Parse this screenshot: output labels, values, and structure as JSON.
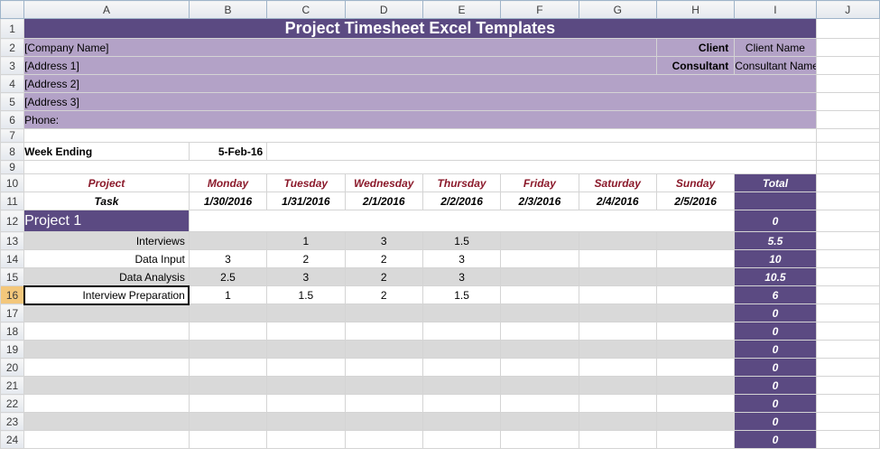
{
  "columns": [
    "A",
    "B",
    "C",
    "D",
    "E",
    "F",
    "G",
    "H",
    "I",
    "J"
  ],
  "rowcount": 24,
  "title": "Project Timesheet Excel Templates",
  "company": {
    "name": "[Company Name]",
    "addr1": "[Address 1]",
    "addr2": "[Address 2]",
    "addr3": "[Address 3]",
    "phone_label": "Phone:"
  },
  "client_label": "Client",
  "client_value": "Client Name",
  "consultant_label": "Consultant",
  "consultant_value": "Consultant Name",
  "week_ending_label": "Week Ending",
  "week_ending_value": "5-Feb-16",
  "headers": {
    "project": "Project",
    "task": "Task",
    "days": [
      "Monday",
      "Tuesday",
      "Wednesday",
      "Thursday",
      "Friday",
      "Saturday",
      "Sunday"
    ],
    "dates": [
      "1/30/2016",
      "1/31/2016",
      "2/1/2016",
      "2/2/2016",
      "2/3/2016",
      "2/4/2016",
      "2/5/2016"
    ],
    "total": "Total"
  },
  "project_name": "Project 1",
  "tasks": [
    {
      "name": "Interviews",
      "vals": [
        "",
        "1",
        "3",
        "1.5",
        "",
        "",
        ""
      ],
      "total": "5.5"
    },
    {
      "name": "Data Input",
      "vals": [
        "3",
        "2",
        "2",
        "3",
        "",
        "",
        ""
      ],
      "total": "10"
    },
    {
      "name": "Data Analysis",
      "vals": [
        "2.5",
        "3",
        "2",
        "3",
        "",
        "",
        ""
      ],
      "total": "10.5"
    },
    {
      "name": "Interview Preparation",
      "vals": [
        "1",
        "1.5",
        "2",
        "1.5",
        "",
        "",
        ""
      ],
      "total": "6"
    }
  ],
  "empty_totals": [
    "0",
    "0",
    "0",
    "0",
    "0",
    "0",
    "0",
    "0",
    "0"
  ],
  "selected_row": 16
}
